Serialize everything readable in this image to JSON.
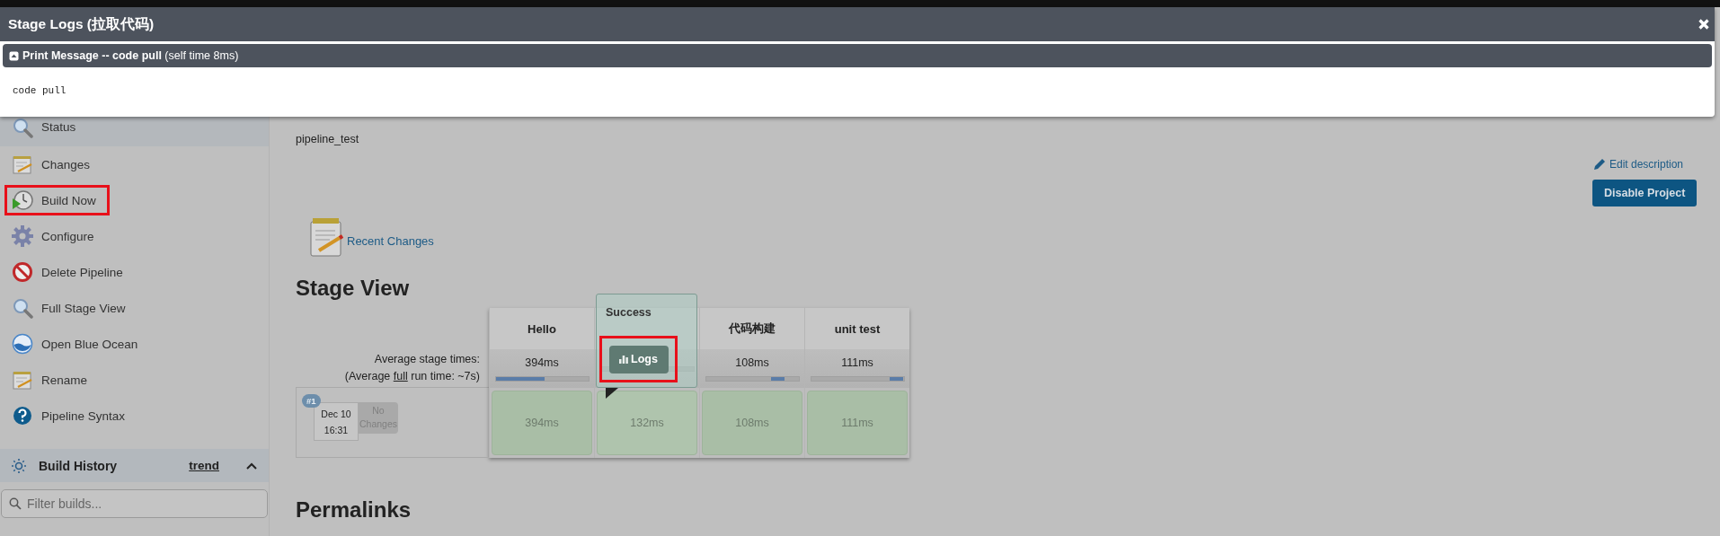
{
  "modal": {
    "title": "Stage Logs (拉取代码)",
    "step": {
      "expanded": true,
      "name": "Print Message -- code pull",
      "time": "(self time 8ms)",
      "log": "code pull"
    }
  },
  "sidebar": {
    "items": [
      {
        "label": "Status",
        "kind": "search",
        "selected": true,
        "outlined": false
      },
      {
        "label": "Changes",
        "kind": "notes",
        "selected": false,
        "outlined": false
      },
      {
        "label": "Build Now",
        "kind": "build",
        "selected": false,
        "outlined": true
      },
      {
        "label": "Configure",
        "kind": "gear",
        "selected": false,
        "outlined": false
      },
      {
        "label": "Delete Pipeline",
        "kind": "delete",
        "selected": false,
        "outlined": false
      },
      {
        "label": "Full Stage View",
        "kind": "search",
        "selected": false,
        "outlined": false
      },
      {
        "label": "Open Blue Ocean",
        "kind": "ocean",
        "selected": false,
        "outlined": false
      },
      {
        "label": "Rename",
        "kind": "notes",
        "selected": false,
        "outlined": false
      },
      {
        "label": "Pipeline Syntax",
        "kind": "help",
        "selected": false,
        "outlined": false
      }
    ],
    "build_history": {
      "title": "Build History",
      "trend": "trend",
      "expanded": true,
      "filter_placeholder": "Filter builds..."
    }
  },
  "main": {
    "description": "pipeline_test",
    "edit_link": "Edit description",
    "disable_button": "Disable Project",
    "recent_changes": "Recent Changes",
    "stage_view": {
      "title": "Stage View",
      "avg_label": "Average stage times:",
      "avg_full_before": "(Average ",
      "avg_full_link": "full",
      "avg_full_after": " run time: ~7s)",
      "stages": [
        {
          "name": "Hello",
          "avg": "394ms"
        },
        {
          "popover": {
            "title": "Success",
            "button": "Logs",
            "outlined": true
          }
        },
        {
          "name": "代码构建",
          "avg": "108ms"
        },
        {
          "name": "unit test",
          "avg": "111ms"
        }
      ],
      "runs": [
        {
          "number": "#1",
          "date": "Dec 10",
          "time": "16:31",
          "changes": "No Changes",
          "cells": [
            {
              "time": "394ms"
            },
            {
              "time": "132ms"
            },
            {
              "time": "108ms"
            },
            {
              "time": "111ms"
            }
          ]
        }
      ]
    },
    "permalinks": "Permalinks"
  }
}
